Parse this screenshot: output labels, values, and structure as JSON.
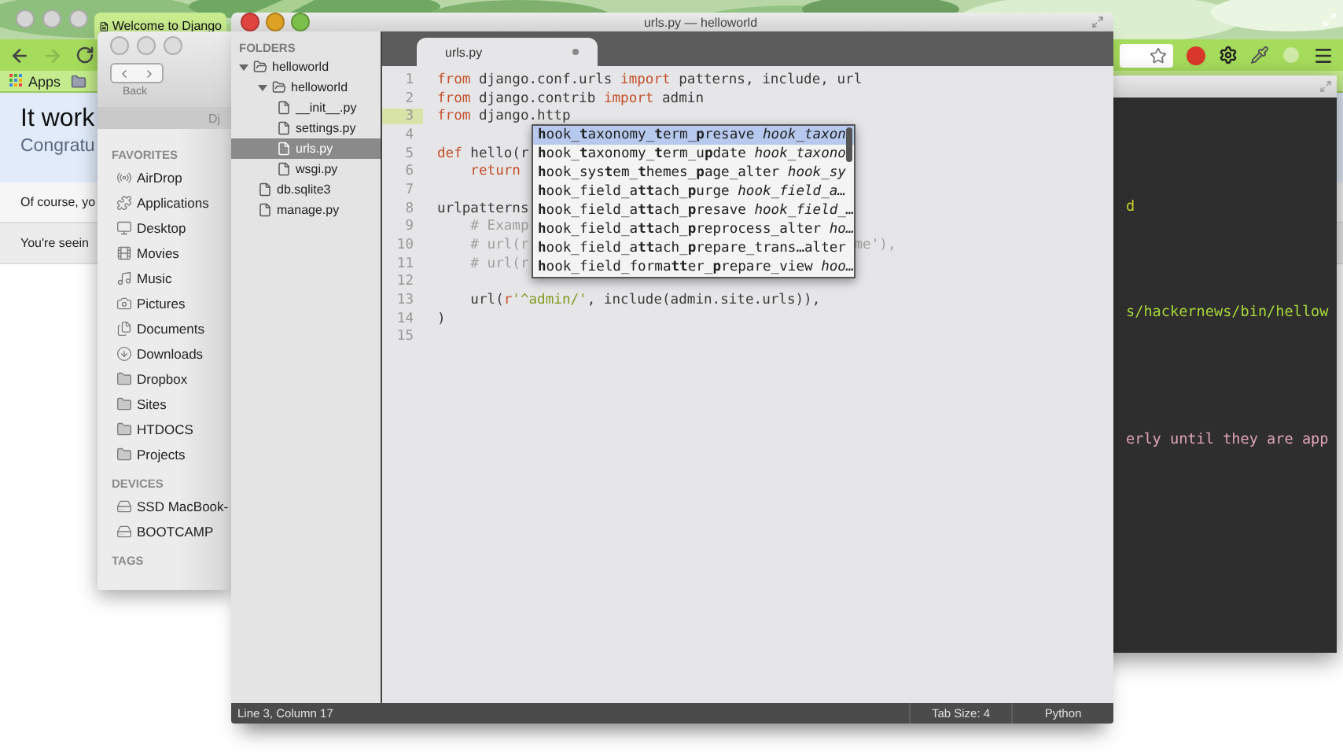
{
  "browser": {
    "tab_title": "Welcome to Django",
    "bookmarks": [
      {
        "label": "Apps"
      }
    ],
    "page": {
      "heading": "It work",
      "subheading": "Congratu",
      "notes": [
        "Of course, yo",
        "You're seein"
      ]
    }
  },
  "finder": {
    "path_title": "Dj",
    "back_label": "Back",
    "sections": [
      {
        "title": "FAVORITES",
        "items": [
          {
            "label": "AirDrop",
            "kind": "airdrop"
          },
          {
            "label": "Applications",
            "kind": "apps"
          },
          {
            "label": "Desktop",
            "kind": "desktop"
          },
          {
            "label": "Movies",
            "kind": "movies"
          },
          {
            "label": "Music",
            "kind": "music"
          },
          {
            "label": "Pictures",
            "kind": "pictures"
          },
          {
            "label": "Documents",
            "kind": "documents"
          },
          {
            "label": "Downloads",
            "kind": "downloads"
          },
          {
            "label": "Dropbox",
            "kind": "folder"
          },
          {
            "label": "Sites",
            "kind": "folder"
          },
          {
            "label": "HTDOCS",
            "kind": "folder"
          },
          {
            "label": "Projects",
            "kind": "folder"
          }
        ]
      },
      {
        "title": "DEVICES",
        "items": [
          {
            "label": "SSD MacBook-",
            "kind": "disk"
          },
          {
            "label": "BOOTCAMP",
            "kind": "disk"
          }
        ]
      },
      {
        "title": "TAGS"
      }
    ]
  },
  "terminal": {
    "lines": [
      {
        "text": "d",
        "color": "#c8d22a"
      },
      {
        "text": "s/hackernews/bin/hellow",
        "color": "#a6d63c"
      },
      {
        "text": "erly until they are app",
        "color": "#e0a4b4"
      }
    ]
  },
  "editor": {
    "title": "urls.py — helloworld",
    "sidebar_title": "FOLDERS",
    "tree": [
      {
        "label": "helloworld",
        "kind": "folder",
        "expanded": true,
        "selected": false,
        "children": [
          {
            "label": "helloworld",
            "kind": "folder",
            "expanded": true,
            "selected": false,
            "children": [
              {
                "label": "__init__.py",
                "kind": "file",
                "selected": false
              },
              {
                "label": "settings.py",
                "kind": "file",
                "selected": false
              },
              {
                "label": "urls.py",
                "kind": "file",
                "selected": true
              },
              {
                "label": "wsgi.py",
                "kind": "file",
                "selected": false
              }
            ]
          },
          {
            "label": "db.sqlite3",
            "kind": "file",
            "selected": false
          },
          {
            "label": "manage.py",
            "kind": "file",
            "selected": false
          }
        ]
      }
    ],
    "tab": {
      "label": "urls.py",
      "modified": true
    },
    "lines": [
      {
        "number": "1",
        "current": false,
        "tokens": [
          {
            "text": "from",
            "kind": "keyword"
          },
          {
            "text": " django.conf.urls ",
            "kind": "plain"
          },
          {
            "text": "import",
            "kind": "keyword"
          },
          {
            "text": " patterns, include, url",
            "kind": "plain"
          }
        ]
      },
      {
        "number": "2",
        "current": false,
        "tokens": [
          {
            "text": "from",
            "kind": "keyword"
          },
          {
            "text": " django.contrib ",
            "kind": "plain"
          },
          {
            "text": "import",
            "kind": "keyword"
          },
          {
            "text": " admin",
            "kind": "plain"
          }
        ]
      },
      {
        "number": "3",
        "current": true,
        "tokens": [
          {
            "text": "from",
            "kind": "keyword"
          },
          {
            "text": " django.http",
            "kind": "plain"
          }
        ]
      },
      {
        "number": "4",
        "current": false
      },
      {
        "number": "5",
        "current": false,
        "tokens": [
          {
            "text": "def",
            "kind": "keyword"
          },
          {
            "text": " hello(r",
            "kind": "plain"
          }
        ]
      },
      {
        "number": "6",
        "current": false,
        "tokens": [
          {
            "text": "    return",
            "kind": "keyword"
          }
        ]
      },
      {
        "number": "7",
        "current": false
      },
      {
        "number": "8",
        "current": false,
        "tokens": [
          {
            "text": "urlpatterns",
            "kind": "plain"
          }
        ]
      },
      {
        "number": "9",
        "current": false,
        "tokens": [
          {
            "text": "    # Examp",
            "kind": "comment"
          }
        ]
      },
      {
        "number": "10",
        "current": false,
        "tokens": [
          {
            "text": "    # url(r",
            "kind": "comment"
          }
        ],
        "tail": "me'),"
      },
      {
        "number": "11",
        "current": false,
        "tokens": [
          {
            "text": "    # url(r",
            "kind": "comment"
          }
        ]
      },
      {
        "number": "12",
        "current": false
      },
      {
        "number": "13",
        "current": false,
        "tokens": [
          {
            "text": "    url(",
            "kind": "plain"
          },
          {
            "text": "r",
            "kind": "keyword"
          },
          {
            "text": "'^admin/'",
            "kind": "string"
          },
          {
            "text": ", include(admin.site.urls)),",
            "kind": "plain"
          }
        ]
      },
      {
        "number": "14",
        "current": false,
        "tokens": [
          {
            "text": ")",
            "kind": "plain"
          }
        ]
      },
      {
        "number": "15",
        "current": false
      }
    ],
    "autocomplete": [
      {
        "name": "**h**ook_**t**axonomy_**t**erm_**p**resave",
        "hint": "hook_taxon",
        "selected": true
      },
      {
        "name": "**h**ook_**t**axonomy_**t**erm_u**p**date",
        "hint": "hook_taxono",
        "selected": false
      },
      {
        "name": "**h**ook_sys**t**em_**t**hemes_**p**age_alter",
        "hint": "hook_sy",
        "selected": false
      },
      {
        "name": "**h**ook_field_a**tt**ach_**p**urge",
        "hint": "hook_field_a…",
        "selected": false
      },
      {
        "name": "**h**ook_field_a**tt**ach_**p**resave",
        "hint": "hook_field_…",
        "selected": false
      },
      {
        "name": "**h**ook_field_a**tt**ach_**p**reprocess_alter",
        "hint": "ho…",
        "selected": false
      },
      {
        "name": "**h**ook_field_a**tt**ach_**p**repare_trans…alter",
        "selected": false
      },
      {
        "name": "**h**ook_field_forma**tt**er_**p**repare_view",
        "hint": "hoo…",
        "selected": false
      }
    ],
    "status": {
      "position": "Line 3, Column 17",
      "tab_size": "Tab Size: 4",
      "syntax": "Python"
    }
  }
}
